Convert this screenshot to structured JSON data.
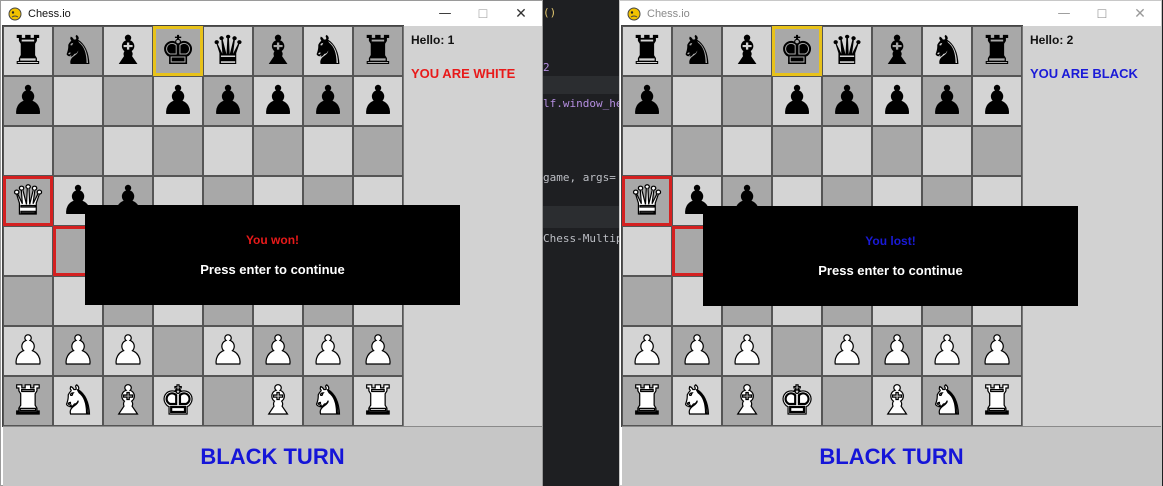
{
  "windows": [
    {
      "title": "Chess.io",
      "hello": "Hello: 1",
      "color_msg": "YOU ARE WHITE",
      "color_msg_color": "#e81a1a",
      "turn_text": "BLACK TURN",
      "overlay": {
        "result": "You won!",
        "result_color": "#e81a1a",
        "prompt": "Press enter to continue"
      }
    },
    {
      "title": "Chess.io",
      "hello": "Hello: 2",
      "color_msg": "YOU ARE BLACK",
      "color_msg_color": "#1a1ad8",
      "turn_text": "BLACK TURN",
      "overlay": {
        "result": "You lost!",
        "result_color": "#1a1ad8",
        "prompt": "Press enter to continue"
      }
    }
  ],
  "titlebar_controls": {
    "minimize": "—",
    "maximize": "☐",
    "close": "✕"
  },
  "board": {
    "rows": [
      [
        "bR",
        "bN",
        "bB",
        "bK",
        "bQ",
        "bB",
        "bN",
        "bR"
      ],
      [
        "bP",
        "",
        "",
        "bP",
        "bP",
        "bP",
        "bP",
        "bP"
      ],
      [
        "",
        "",
        "",
        "",
        "",
        "",
        "",
        ""
      ],
      [
        "wQ",
        "bP",
        "bP",
        "",
        "",
        "",
        "",
        ""
      ],
      [
        "",
        "",
        "",
        "",
        "",
        "",
        "",
        ""
      ],
      [
        "",
        "",
        "",
        "",
        "",
        "",
        "",
        ""
      ],
      [
        "wP",
        "wP",
        "wP",
        "",
        "wP",
        "wP",
        "wP",
        "wP"
      ],
      [
        "wR",
        "wN",
        "wB",
        "wK",
        "",
        "wB",
        "wN",
        "wR"
      ]
    ],
    "highlight_yellow": [
      [
        0,
        3
      ]
    ],
    "highlight_red": [
      [
        3,
        0
      ],
      [
        4,
        1
      ]
    ]
  },
  "editor": {
    "lines": [
      "()",
      "2",
      "lf.window_he",
      "game, args=",
      "Chess-Multip"
    ]
  },
  "colors": {
    "turn_text": "#1515d8",
    "light_square": "#d4d4d4",
    "dark_square": "#a8a8a8"
  }
}
